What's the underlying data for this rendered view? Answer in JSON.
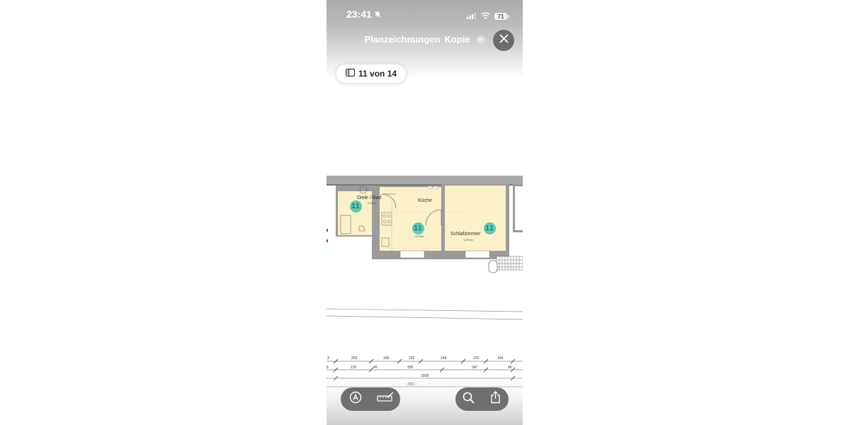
{
  "status": {
    "time": "23:41",
    "battery": "71"
  },
  "header": {
    "title": "Planzeichnungen",
    "subtitle": "Kopie"
  },
  "pager": {
    "label": "11 von 14"
  },
  "plan": {
    "rooms": [
      {
        "name": "Diele / Bad",
        "area": "5.37qm",
        "badge": "11"
      },
      {
        "name": "Küche",
        "area": "15.40qm",
        "badge": "11"
      },
      {
        "name": "Schlafzimmer",
        "area": "12.87qm",
        "badge": "11"
      }
    ],
    "dims_row1": [
      "3",
      "203",
      "160",
      "120",
      "244",
      "120",
      "154"
    ],
    "dims_row2": [
      "6",
      "210",
      "40",
      "350",
      "347",
      "46"
    ],
    "dims_row3": [
      "1008"
    ],
    "dims_row4": [
      "3301"
    ]
  },
  "colors": {
    "room_fill": "#fbf1c9",
    "wall": "#9a9a9a",
    "badge": "#5fc9b4",
    "toolbar": "#6f6f6f"
  }
}
